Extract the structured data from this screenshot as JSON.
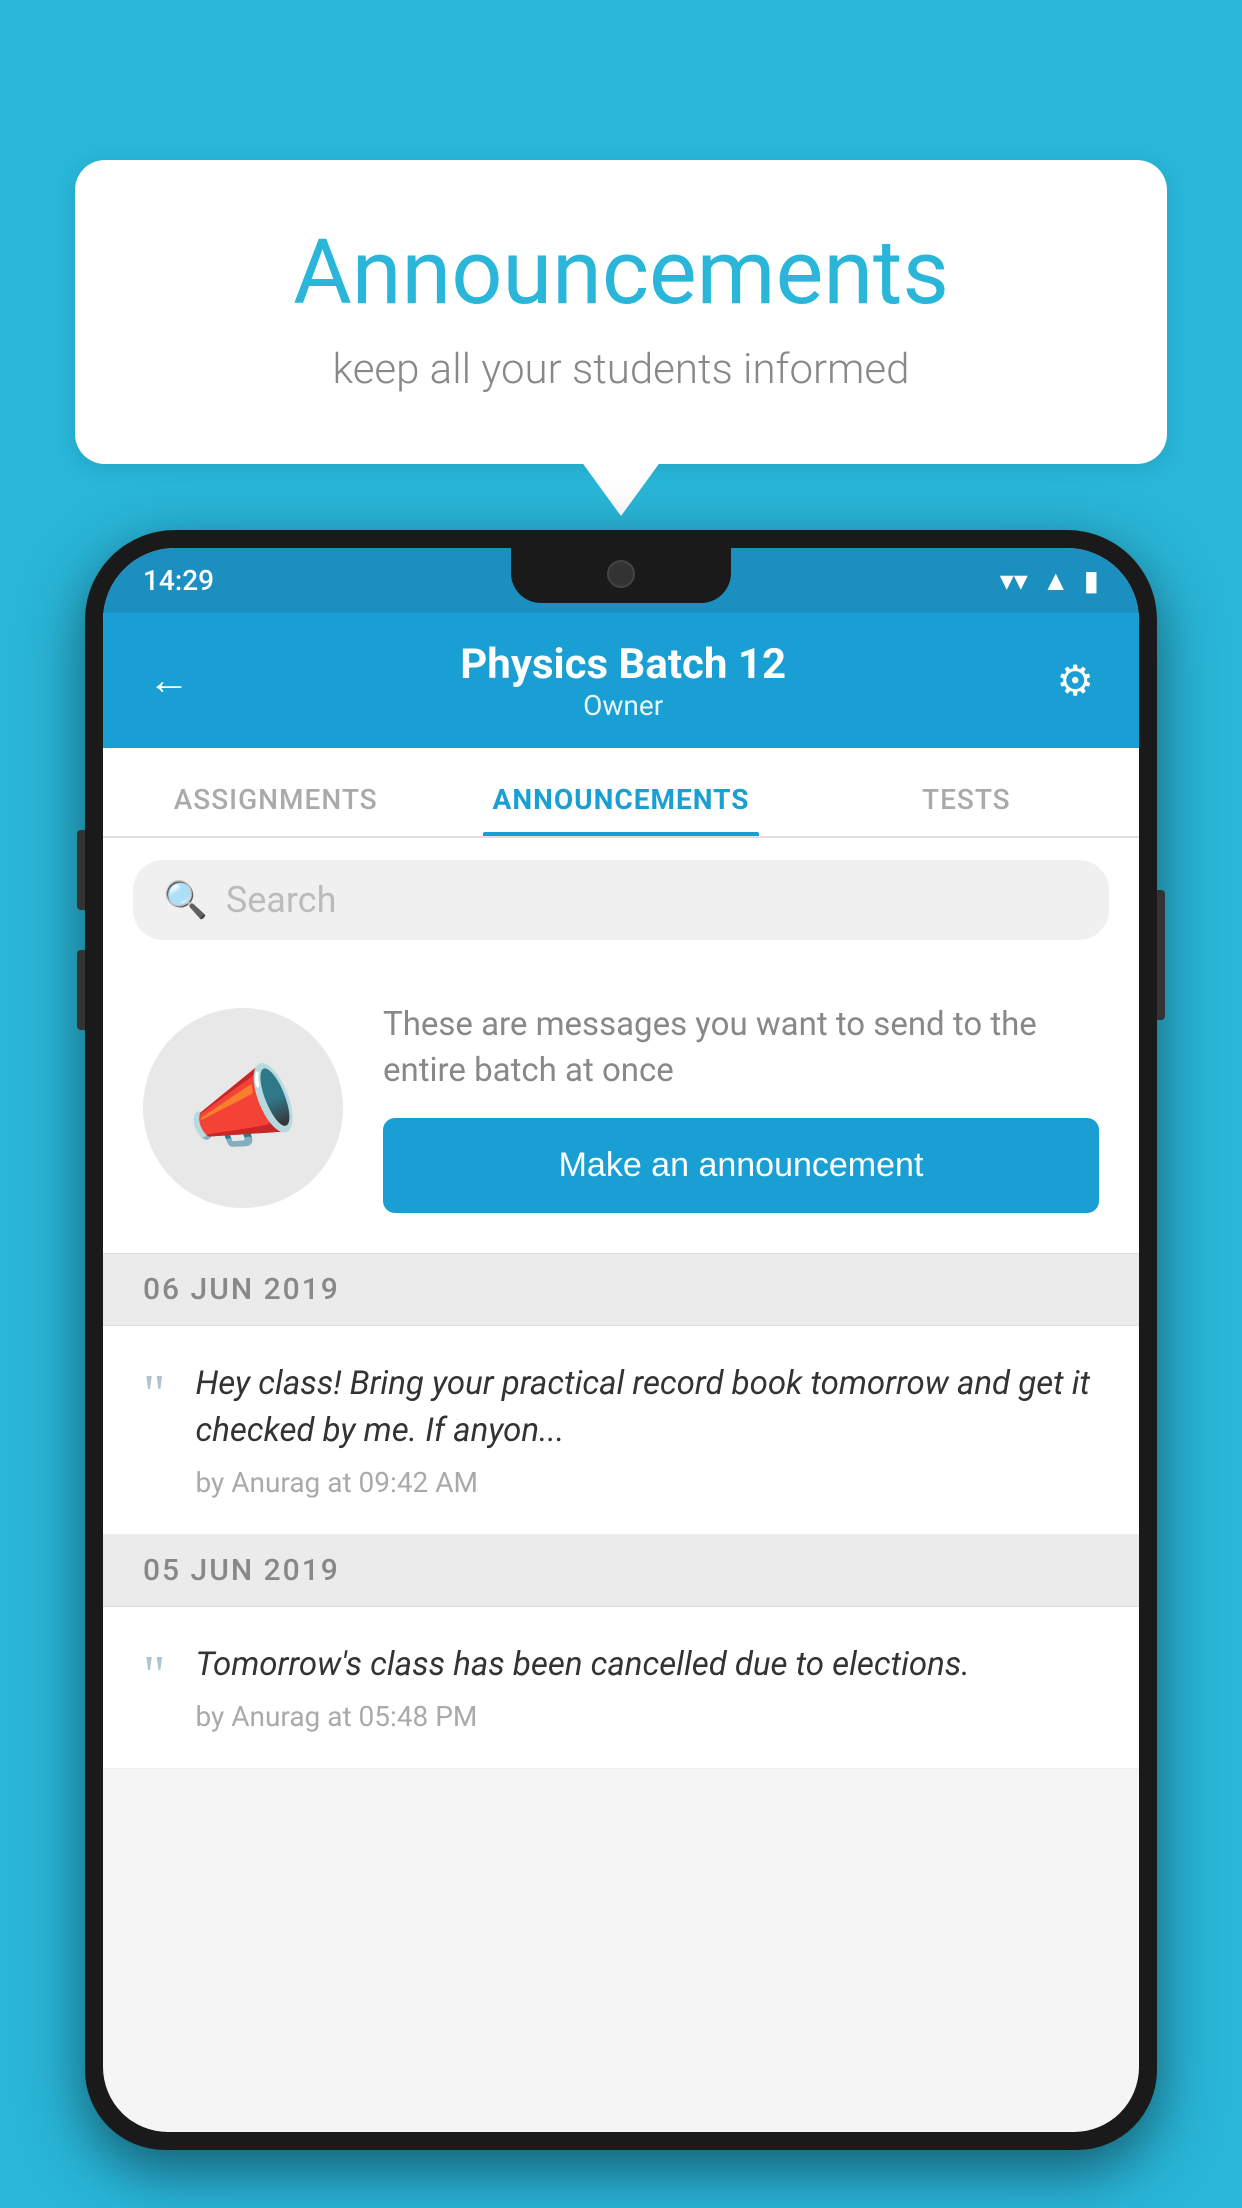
{
  "background": {
    "color": "#29b6d8"
  },
  "speech_bubble": {
    "title": "Announcements",
    "subtitle": "keep all your students informed"
  },
  "phone": {
    "status_bar": {
      "time": "14:29"
    },
    "header": {
      "title": "Physics Batch 12",
      "subtitle": "Owner",
      "back_label": "←",
      "settings_label": "⚙"
    },
    "tabs": [
      {
        "label": "ASSIGNMENTS",
        "active": false
      },
      {
        "label": "ANNOUNCEMENTS",
        "active": true
      },
      {
        "label": "TESTS",
        "active": false
      }
    ],
    "search": {
      "placeholder": "Search"
    },
    "announcement_prompt": {
      "description_text": "These are messages you want to send to the entire batch at once",
      "button_label": "Make an announcement"
    },
    "announcements": [
      {
        "date": "06  JUN  2019",
        "text": "Hey class! Bring your practical record book tomorrow and get it checked by me. If anyon...",
        "meta": "by Anurag at 09:42 AM"
      },
      {
        "date": "05  JUN  2019",
        "text": "Tomorrow's class has been cancelled due to elections.",
        "meta": "by Anurag at 05:48 PM"
      }
    ]
  }
}
